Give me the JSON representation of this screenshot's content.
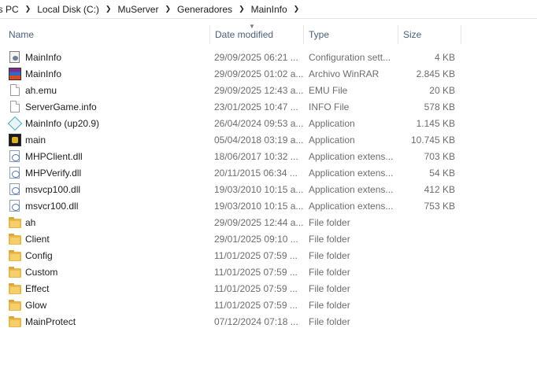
{
  "breadcrumb": [
    "is PC",
    "Local Disk (C:)",
    "MuServer",
    "Generadores",
    "MainInfo"
  ],
  "columns": {
    "name": "Name",
    "date": "Date modified",
    "type": "Type",
    "size": "Size"
  },
  "files": [
    {
      "name": "MainInfo",
      "date": "29/09/2025 06:21 ...",
      "type": "Configuration sett...",
      "size": "4 KB",
      "icon": "config-icon"
    },
    {
      "name": "MainInfo",
      "date": "29/09/2025 01:02 a...",
      "type": "Archivo WinRAR",
      "size": "2.845 KB",
      "icon": "winrar-icon"
    },
    {
      "name": "ah.emu",
      "date": "29/09/2025 12:43 a...",
      "type": "EMU File",
      "size": "20 KB",
      "icon": "file-icon"
    },
    {
      "name": "ServerGame.info",
      "date": "23/01/2025 10:47 ...",
      "type": "INFO File",
      "size": "578 KB",
      "icon": "file-icon"
    },
    {
      "name": "MainInfo (up20.9)",
      "date": "26/04/2024 09:53 a...",
      "type": "Application",
      "size": "1.145 KB",
      "icon": "app-icon"
    },
    {
      "name": "main",
      "date": "05/04/2018 03:19 a...",
      "type": "Application",
      "size": "10.745 KB",
      "icon": "main-app-icon"
    },
    {
      "name": "MHPClient.dll",
      "date": "18/06/2017 10:32 ...",
      "type": "Application extens...",
      "size": "703 KB",
      "icon": "dll-icon"
    },
    {
      "name": "MHPVerify.dll",
      "date": "20/11/2015 06:34 ...",
      "type": "Application extens...",
      "size": "54 KB",
      "icon": "dll-icon"
    },
    {
      "name": "msvcp100.dll",
      "date": "19/03/2010 10:15 a...",
      "type": "Application extens...",
      "size": "412 KB",
      "icon": "dll-icon"
    },
    {
      "name": "msvcr100.dll",
      "date": "19/03/2010 10:15 a...",
      "type": "Application extens...",
      "size": "753 KB",
      "icon": "dll-icon"
    },
    {
      "name": "ah",
      "date": "29/09/2025 12:44 a...",
      "type": "File folder",
      "size": "",
      "icon": "folder-icon"
    },
    {
      "name": "Client",
      "date": "29/01/2025 09:10 ...",
      "type": "File folder",
      "size": "",
      "icon": "folder-icon"
    },
    {
      "name": "Config",
      "date": "11/01/2025 07:59 ...",
      "type": "File folder",
      "size": "",
      "icon": "folder-icon"
    },
    {
      "name": "Custom",
      "date": "11/01/2025 07:59 ...",
      "type": "File folder",
      "size": "",
      "icon": "folder-icon"
    },
    {
      "name": "Effect",
      "date": "11/01/2025 07:59 ...",
      "type": "File folder",
      "size": "",
      "icon": "folder-icon"
    },
    {
      "name": "Glow",
      "date": "11/01/2025 07:59 ...",
      "type": "File folder",
      "size": "",
      "icon": "folder-icon"
    },
    {
      "name": "MainProtect",
      "date": "07/12/2024 07:18 ...",
      "type": "File folder",
      "size": "",
      "icon": "folder-icon"
    }
  ]
}
